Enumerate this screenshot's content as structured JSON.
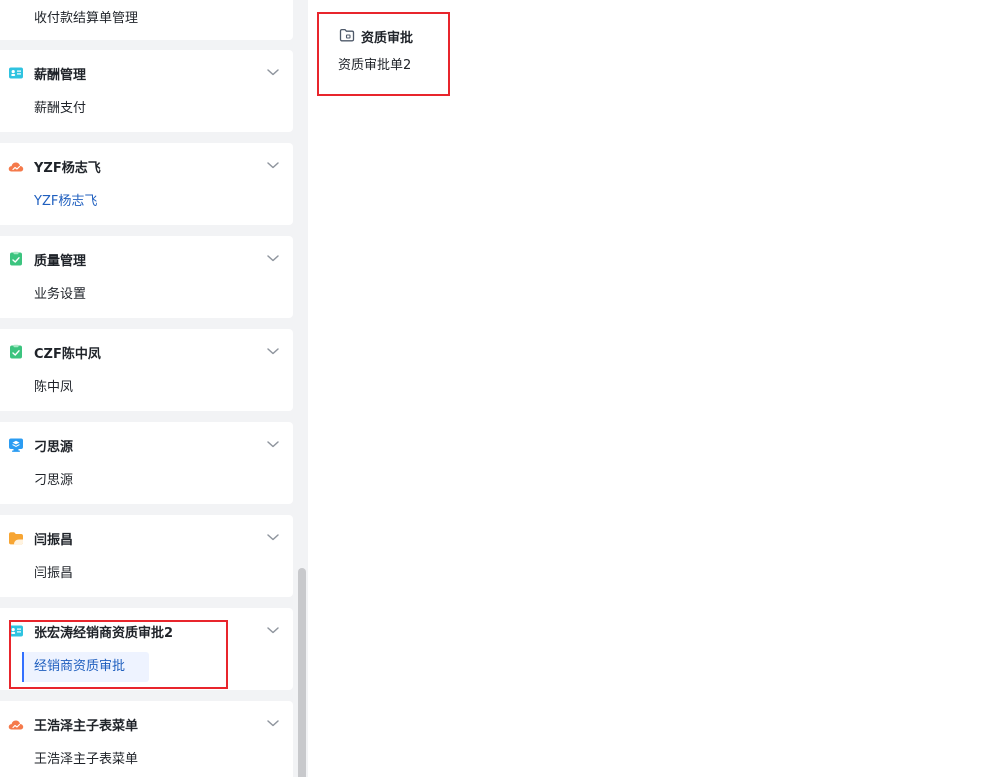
{
  "sidebar": {
    "top_item": "收付款结算单管理",
    "groups": [
      {
        "title": "薪酬管理",
        "icon": "id-card-icon",
        "item": "薪酬支付",
        "item_state": "normal"
      },
      {
        "title": "YZF杨志飞",
        "icon": "cloud-icon",
        "item": "YZF杨志飞",
        "item_state": "link"
      },
      {
        "title": "质量管理",
        "icon": "checklist-icon",
        "item": "业务设置",
        "item_state": "normal"
      },
      {
        "title": "CZF陈中凤",
        "icon": "checklist-icon",
        "item": "陈中凤",
        "item_state": "normal"
      },
      {
        "title": "刁思源",
        "icon": "monitor-layers-icon",
        "item": "刁思源",
        "item_state": "normal"
      },
      {
        "title": "闫振昌",
        "icon": "folder-icon",
        "item": "闫振昌",
        "item_state": "normal"
      },
      {
        "title": "张宏涛经销商资质审批2",
        "icon": "id-card-icon",
        "item": "经销商资质审批",
        "item_state": "active"
      },
      {
        "title": "王浩泽主子表菜单",
        "icon": "cloud-icon",
        "item": "王浩泽主子表菜单",
        "item_state": "normal"
      }
    ]
  },
  "main": {
    "section_title": "资质审批",
    "section_icon": "folder-icon",
    "items": [
      "资质审批单2"
    ]
  },
  "colors": {
    "highlight_border": "#e8252c",
    "active_text": "#1f5fbf",
    "active_bg": "#eef3ff",
    "sidebar_bg": "#f2f3f5"
  }
}
